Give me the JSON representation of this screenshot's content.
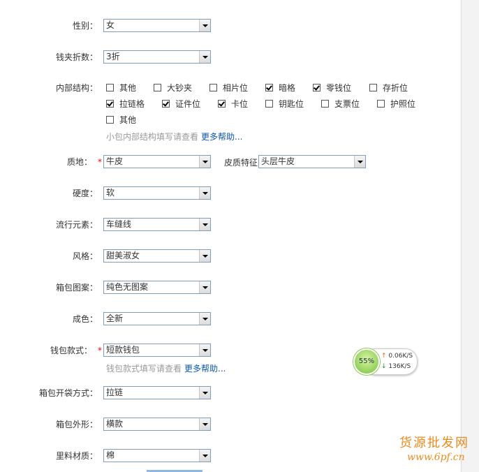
{
  "fields": {
    "gender": {
      "label": "性别：",
      "value": "女"
    },
    "wallet_fold": {
      "label": "钱夹折数：",
      "value": "3折"
    },
    "internal": {
      "label": "内部结构："
    },
    "material": {
      "label": "质地：",
      "value": "牛皮"
    },
    "leather": {
      "label": "皮质特征",
      "value": "头层牛皮"
    },
    "hardness": {
      "label": "硬度：",
      "value": "软"
    },
    "popular": {
      "label": "流行元素：",
      "value": "车缝线"
    },
    "style": {
      "label": "风格：",
      "value": "甜美淑女"
    },
    "pattern": {
      "label": "箱包图案：",
      "value": "纯色无图案"
    },
    "condition": {
      "label": "成色：",
      "value": "全新"
    },
    "wallet_style": {
      "label": "钱包款式：",
      "value": "短款钱包"
    },
    "opening": {
      "label": "箱包开袋方式：",
      "value": "拉链"
    },
    "shape": {
      "label": "箱包外形：",
      "value": "横款"
    },
    "lining": {
      "label": "里料材质：",
      "value": "棉"
    }
  },
  "checkboxes": [
    {
      "label": "其他",
      "checked": false
    },
    {
      "label": "大钞夹",
      "checked": false
    },
    {
      "label": "相片位",
      "checked": false
    },
    {
      "label": "暗格",
      "checked": true
    },
    {
      "label": "零钱位",
      "checked": true
    },
    {
      "label": "存折位",
      "checked": false
    },
    {
      "label": "拉链格",
      "checked": true
    },
    {
      "label": "证件位",
      "checked": true
    },
    {
      "label": "卡位",
      "checked": true
    },
    {
      "label": "钥匙位",
      "checked": false
    },
    {
      "label": "支票位",
      "checked": false
    },
    {
      "label": "护照位",
      "checked": false
    },
    {
      "label": "其他",
      "checked": false
    }
  ],
  "help1": {
    "text": "小包内部结构填写请查看",
    "link": "更多帮助..."
  },
  "help2": {
    "text": "钱包款式填写请查看",
    "link": "更多帮助..."
  },
  "speed": {
    "percent": "55%",
    "up": "0.06K/S",
    "down": "136K/S",
    "up_arrow": "↑",
    "down_arrow": "↓"
  },
  "watermark": {
    "line1": "货源批发网",
    "line2": "www.6pf.cn"
  },
  "colors": {
    "link": "#0e58b5",
    "required": "#e00000",
    "watermark": "#f08a1c"
  }
}
